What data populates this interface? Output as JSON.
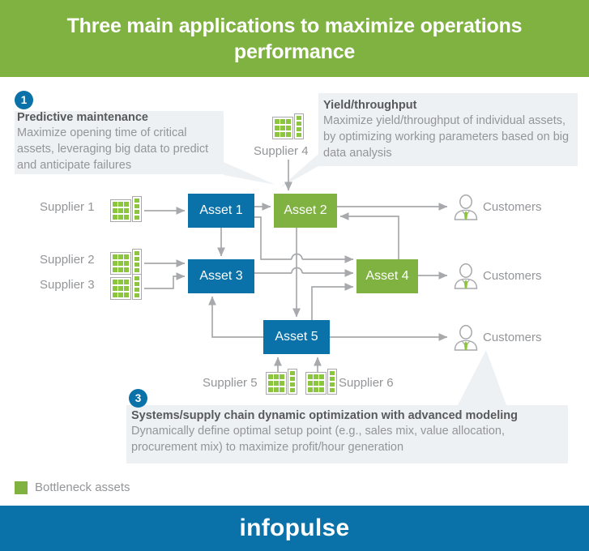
{
  "header": {
    "title": "Three main applications to maximize operations performance"
  },
  "callouts": [
    {
      "badge": "1",
      "title": "Predictive maintenance",
      "body": "Maximize opening time of critical assets, leveraging big data to predict and anticipate failures"
    },
    {
      "badge": "",
      "title": "Yield/throughput",
      "body": "Maximize yield/throughput of individual assets, by optimizing working parameters based on big data analysis"
    },
    {
      "badge": "3",
      "title": "Systems/supply chain dynamic optimization with advanced modeling",
      "body": "Dynamically define optimal setup point (e.g., sales mix, value allocation, procurement mix) to maximize profit/hour generation"
    }
  ],
  "diagram": {
    "assets": [
      {
        "label": "Asset 1",
        "type": "normal"
      },
      {
        "label": "Asset 2",
        "type": "bottleneck"
      },
      {
        "label": "Asset 3",
        "type": "normal"
      },
      {
        "label": "Asset 4",
        "type": "bottleneck"
      },
      {
        "label": "Asset 5",
        "type": "normal"
      }
    ],
    "suppliers": [
      {
        "label": "Supplier 1"
      },
      {
        "label": "Supplier 2"
      },
      {
        "label": "Supplier 3"
      },
      {
        "label": "Supplier 4"
      },
      {
        "label": "Supplier 5"
      },
      {
        "label": "Supplier 6"
      }
    ],
    "customers": [
      {
        "label": "Customers"
      },
      {
        "label": "Customers"
      },
      {
        "label": "Customers"
      }
    ]
  },
  "legend": {
    "label": "Bottleneck assets",
    "color": "#7fb241"
  },
  "footer": {
    "logo": "infopulse",
    "color": "#0a72a8"
  },
  "colors": {
    "header_green": "#7fb241",
    "asset_blue": "#0a72a8",
    "asset_green": "#7fb241",
    "callout_bg": "#eef1f4",
    "text_gray": "#939598",
    "title_gray": "#58595b",
    "line_gray": "#a7a9ac"
  }
}
